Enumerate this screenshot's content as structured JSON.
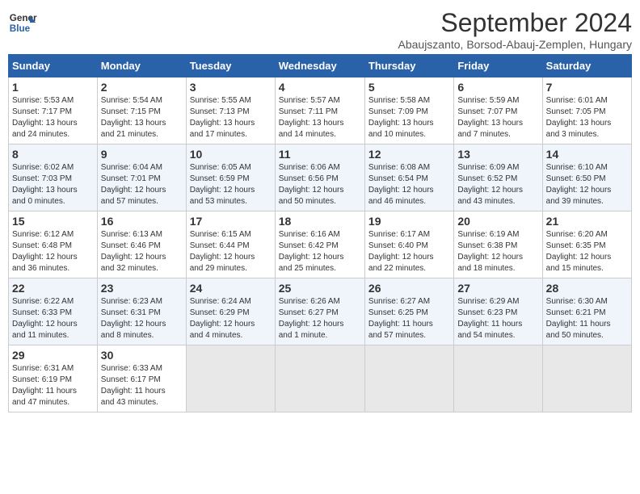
{
  "header": {
    "logo_line1": "General",
    "logo_line2": "Blue",
    "month_title": "September 2024",
    "location": "Abaujszanto, Borsod-Abauj-Zemplen, Hungary"
  },
  "weekdays": [
    "Sunday",
    "Monday",
    "Tuesday",
    "Wednesday",
    "Thursday",
    "Friday",
    "Saturday"
  ],
  "weeks": [
    [
      {
        "day": "1",
        "info": "Sunrise: 5:53 AM\nSunset: 7:17 PM\nDaylight: 13 hours\nand 24 minutes."
      },
      {
        "day": "2",
        "info": "Sunrise: 5:54 AM\nSunset: 7:15 PM\nDaylight: 13 hours\nand 21 minutes."
      },
      {
        "day": "3",
        "info": "Sunrise: 5:55 AM\nSunset: 7:13 PM\nDaylight: 13 hours\nand 17 minutes."
      },
      {
        "day": "4",
        "info": "Sunrise: 5:57 AM\nSunset: 7:11 PM\nDaylight: 13 hours\nand 14 minutes."
      },
      {
        "day": "5",
        "info": "Sunrise: 5:58 AM\nSunset: 7:09 PM\nDaylight: 13 hours\nand 10 minutes."
      },
      {
        "day": "6",
        "info": "Sunrise: 5:59 AM\nSunset: 7:07 PM\nDaylight: 13 hours\nand 7 minutes."
      },
      {
        "day": "7",
        "info": "Sunrise: 6:01 AM\nSunset: 7:05 PM\nDaylight: 13 hours\nand 3 minutes."
      }
    ],
    [
      {
        "day": "8",
        "info": "Sunrise: 6:02 AM\nSunset: 7:03 PM\nDaylight: 13 hours\nand 0 minutes."
      },
      {
        "day": "9",
        "info": "Sunrise: 6:04 AM\nSunset: 7:01 PM\nDaylight: 12 hours\nand 57 minutes."
      },
      {
        "day": "10",
        "info": "Sunrise: 6:05 AM\nSunset: 6:59 PM\nDaylight: 12 hours\nand 53 minutes."
      },
      {
        "day": "11",
        "info": "Sunrise: 6:06 AM\nSunset: 6:56 PM\nDaylight: 12 hours\nand 50 minutes."
      },
      {
        "day": "12",
        "info": "Sunrise: 6:08 AM\nSunset: 6:54 PM\nDaylight: 12 hours\nand 46 minutes."
      },
      {
        "day": "13",
        "info": "Sunrise: 6:09 AM\nSunset: 6:52 PM\nDaylight: 12 hours\nand 43 minutes."
      },
      {
        "day": "14",
        "info": "Sunrise: 6:10 AM\nSunset: 6:50 PM\nDaylight: 12 hours\nand 39 minutes."
      }
    ],
    [
      {
        "day": "15",
        "info": "Sunrise: 6:12 AM\nSunset: 6:48 PM\nDaylight: 12 hours\nand 36 minutes."
      },
      {
        "day": "16",
        "info": "Sunrise: 6:13 AM\nSunset: 6:46 PM\nDaylight: 12 hours\nand 32 minutes."
      },
      {
        "day": "17",
        "info": "Sunrise: 6:15 AM\nSunset: 6:44 PM\nDaylight: 12 hours\nand 29 minutes."
      },
      {
        "day": "18",
        "info": "Sunrise: 6:16 AM\nSunset: 6:42 PM\nDaylight: 12 hours\nand 25 minutes."
      },
      {
        "day": "19",
        "info": "Sunrise: 6:17 AM\nSunset: 6:40 PM\nDaylight: 12 hours\nand 22 minutes."
      },
      {
        "day": "20",
        "info": "Sunrise: 6:19 AM\nSunset: 6:38 PM\nDaylight: 12 hours\nand 18 minutes."
      },
      {
        "day": "21",
        "info": "Sunrise: 6:20 AM\nSunset: 6:35 PM\nDaylight: 12 hours\nand 15 minutes."
      }
    ],
    [
      {
        "day": "22",
        "info": "Sunrise: 6:22 AM\nSunset: 6:33 PM\nDaylight: 12 hours\nand 11 minutes."
      },
      {
        "day": "23",
        "info": "Sunrise: 6:23 AM\nSunset: 6:31 PM\nDaylight: 12 hours\nand 8 minutes."
      },
      {
        "day": "24",
        "info": "Sunrise: 6:24 AM\nSunset: 6:29 PM\nDaylight: 12 hours\nand 4 minutes."
      },
      {
        "day": "25",
        "info": "Sunrise: 6:26 AM\nSunset: 6:27 PM\nDaylight: 12 hours\nand 1 minute."
      },
      {
        "day": "26",
        "info": "Sunrise: 6:27 AM\nSunset: 6:25 PM\nDaylight: 11 hours\nand 57 minutes."
      },
      {
        "day": "27",
        "info": "Sunrise: 6:29 AM\nSunset: 6:23 PM\nDaylight: 11 hours\nand 54 minutes."
      },
      {
        "day": "28",
        "info": "Sunrise: 6:30 AM\nSunset: 6:21 PM\nDaylight: 11 hours\nand 50 minutes."
      }
    ],
    [
      {
        "day": "29",
        "info": "Sunrise: 6:31 AM\nSunset: 6:19 PM\nDaylight: 11 hours\nand 47 minutes."
      },
      {
        "day": "30",
        "info": "Sunrise: 6:33 AM\nSunset: 6:17 PM\nDaylight: 11 hours\nand 43 minutes."
      },
      {
        "day": "",
        "info": ""
      },
      {
        "day": "",
        "info": ""
      },
      {
        "day": "",
        "info": ""
      },
      {
        "day": "",
        "info": ""
      },
      {
        "day": "",
        "info": ""
      }
    ]
  ]
}
